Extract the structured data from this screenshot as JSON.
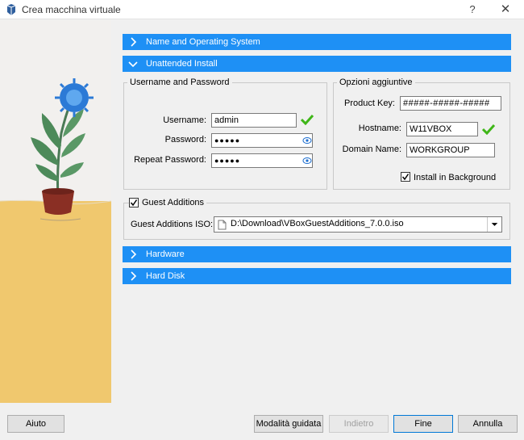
{
  "window": {
    "title": "Crea macchina virtuale",
    "help_label": "?",
    "close_label": "✕"
  },
  "sections": {
    "name_os": "Name and Operating System",
    "unattended": "Unattended Install",
    "hardware": "Hardware",
    "hard_disk": "Hard Disk"
  },
  "credentials": {
    "group_title": "Username and Password",
    "username_label": "Username:",
    "username_value": "admin",
    "password_label": "Password:",
    "password_value": "●●●●●",
    "repeat_label": "Repeat Password:",
    "repeat_value": "●●●●●"
  },
  "options": {
    "group_title": "Opzioni aggiuntive",
    "product_key_label": "Product Key:",
    "product_key_value": "#####-#####-#####",
    "hostname_label": "Hostname:",
    "hostname_value": "W11VBOX",
    "domain_label": "Domain Name:",
    "domain_value": "WORKGROUP",
    "install_bg_label": "Install in Background",
    "install_bg_checked": true
  },
  "guest_additions": {
    "title": "Guest Additions",
    "checked": true,
    "iso_label": "Guest Additions ISO:",
    "iso_value": "D:\\Download\\VBoxGuestAdditions_7.0.0.iso"
  },
  "footer": {
    "help": "Aiuto",
    "guided": "Modalità guidata",
    "back": "Indietro",
    "finish": "Fine",
    "cancel": "Annulla"
  },
  "colors": {
    "section_blue": "#1e90f5",
    "accent_check": "#3fb618"
  }
}
